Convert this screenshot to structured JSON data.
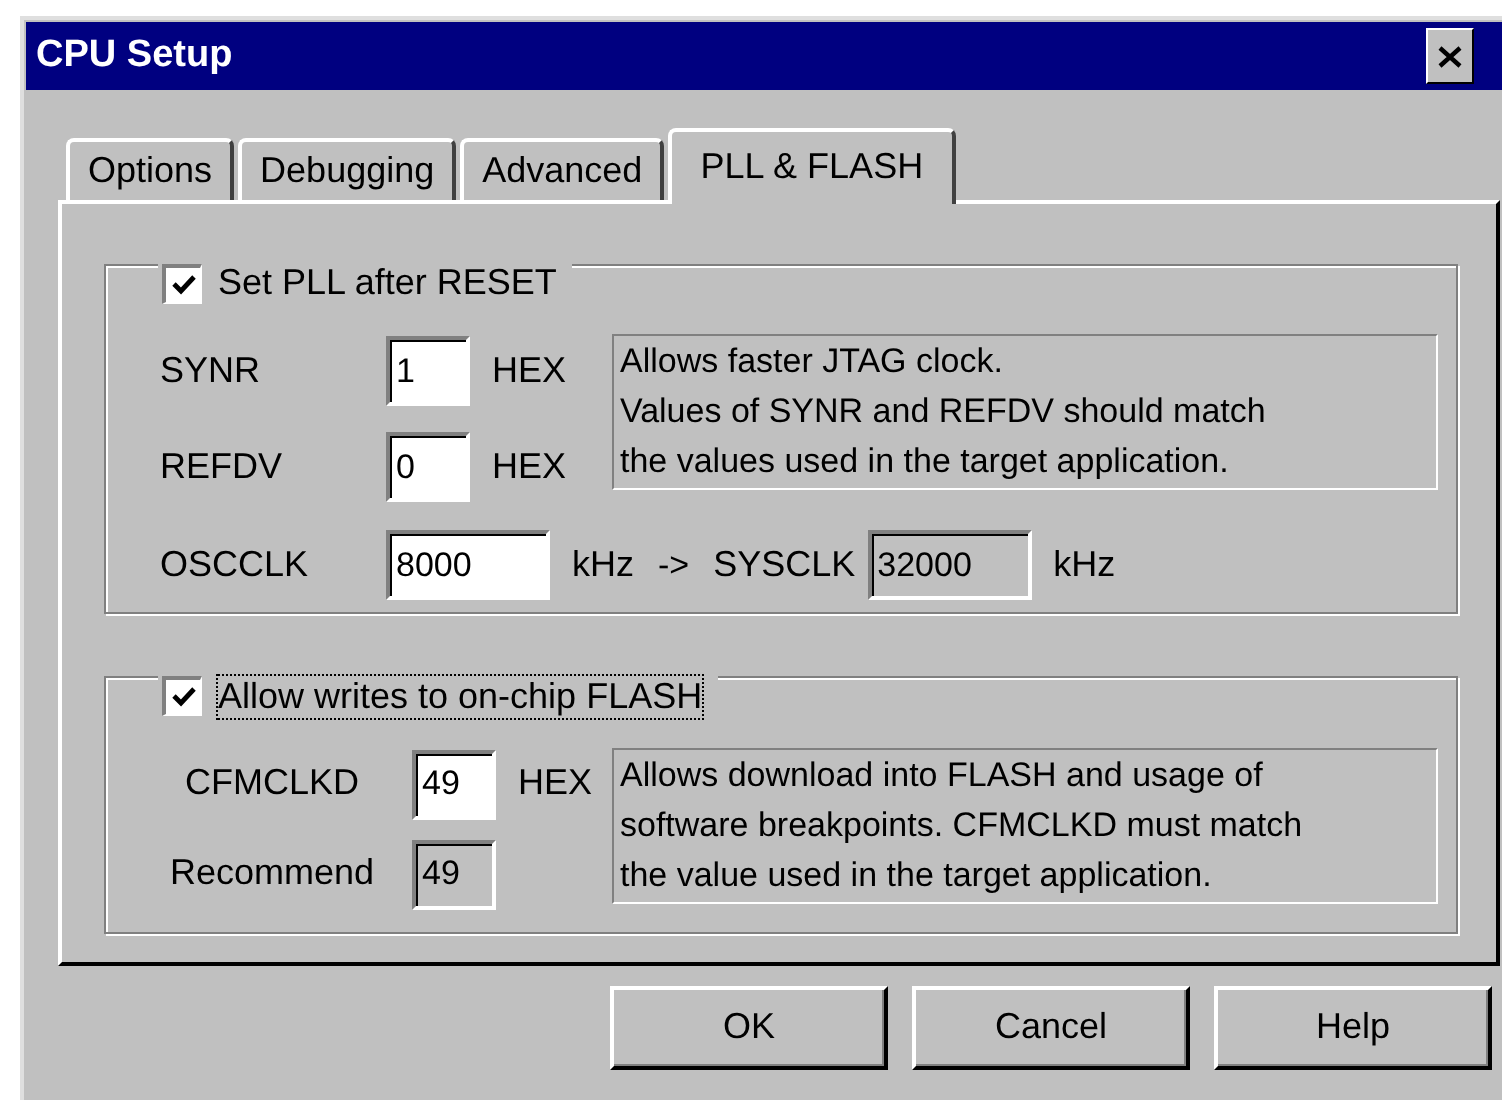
{
  "window": {
    "title": "CPU Setup"
  },
  "tabs": [
    {
      "label": "Options",
      "selected": false
    },
    {
      "label": "Debugging",
      "selected": false
    },
    {
      "label": "Advanced",
      "selected": false
    },
    {
      "label": "PLL & FLASH",
      "selected": true
    }
  ],
  "pll_group": {
    "label": "Set PLL after RESET",
    "checked": true,
    "focused": false,
    "fields": [
      {
        "label": "SYNR",
        "value": "1",
        "unit": "HEX",
        "readonly": false
      },
      {
        "label": "REFDV",
        "value": "0",
        "unit": "HEX",
        "readonly": false
      }
    ],
    "description": [
      "Allows faster JTAG clock.",
      "Values of SYNR and REFDV should match",
      "the values used in the target application."
    ],
    "clock_row": {
      "label": "OSCCLK",
      "value": "8000",
      "unit": "kHz",
      "arrow": "->",
      "result_label": "SYSCLK",
      "result_value": "32000",
      "result_unit": "kHz"
    }
  },
  "flash_group": {
    "label": "Allow writes to on-chip FLASH",
    "checked": true,
    "focused": true,
    "fields": [
      {
        "label": "CFMCLKD",
        "value": "49",
        "unit": "HEX",
        "readonly": false
      },
      {
        "label": "Recommend",
        "value": "49",
        "readonly": true
      }
    ],
    "description": [
      "Allows download into FLASH and usage of",
      "software breakpoints. CFMCLKD must match",
      "the value used in the target application."
    ]
  },
  "buttons": [
    "OK",
    "Cancel",
    "Help"
  ]
}
